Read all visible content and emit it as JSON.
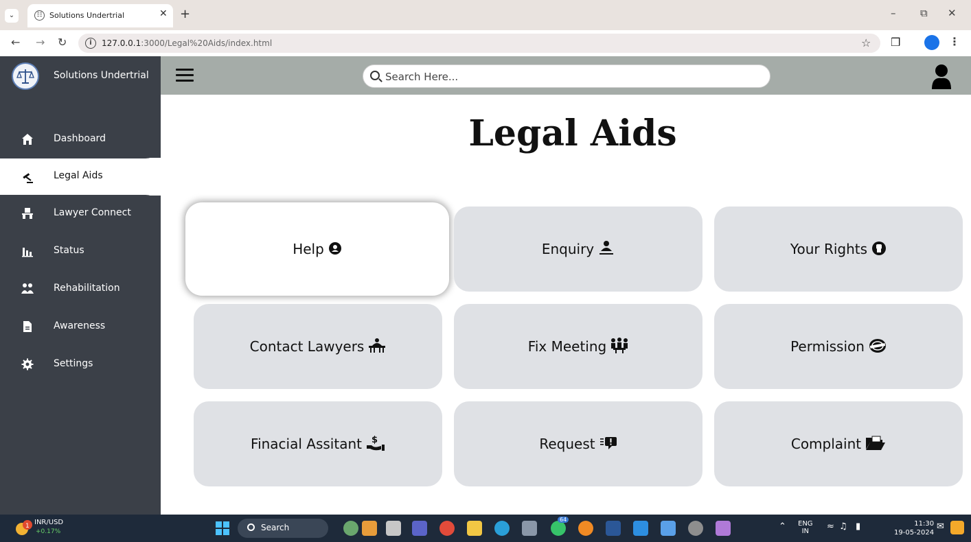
{
  "browser": {
    "tab_title": "Solutions Undertrial",
    "url_host": "127.0.0.1",
    "url_rest": ":3000/Legal%20Aids/index.html"
  },
  "app": {
    "brand": "Solutions Undertrial",
    "search_placeholder": "Search Here...",
    "page_title": "Legal Aids"
  },
  "sidebar": {
    "items": [
      {
        "label": "Dashboard",
        "icon": "home-icon"
      },
      {
        "label": "Legal Aids",
        "icon": "gavel-icon",
        "active": true
      },
      {
        "label": "Lawyer Connect",
        "icon": "lawyer-icon"
      },
      {
        "label": "Status",
        "icon": "bar-chart-icon"
      },
      {
        "label": "Rehabilitation",
        "icon": "people-icon"
      },
      {
        "label": "Awareness",
        "icon": "document-icon"
      },
      {
        "label": "Settings",
        "icon": "gear-icon"
      }
    ]
  },
  "cards": [
    {
      "label": "Help",
      "icon": "help-icon",
      "featured": true
    },
    {
      "label": "Enquiry",
      "icon": "enquiry-icon"
    },
    {
      "label": "Your Rights",
      "icon": "fist-icon"
    },
    {
      "label": "Contact Lawyers",
      "icon": "court-icon"
    },
    {
      "label": "Fix Meeting",
      "icon": "meeting-icon"
    },
    {
      "label": "Permission",
      "icon": "stamp-icon"
    },
    {
      "label": "Finacial Assitant",
      "icon": "money-hand-icon"
    },
    {
      "label": "Request",
      "icon": "request-icon"
    },
    {
      "label": "Complaint",
      "icon": "folder-icon"
    }
  ],
  "taskbar": {
    "ticker_name": "INR/USD",
    "ticker_change": "+0.17%",
    "ticker_badge": "1",
    "search_label": "Search",
    "whatsapp_badge": "64",
    "lang_top": "ENG",
    "lang_bottom": "IN",
    "time": "11:30",
    "date": "19-05-2024"
  }
}
